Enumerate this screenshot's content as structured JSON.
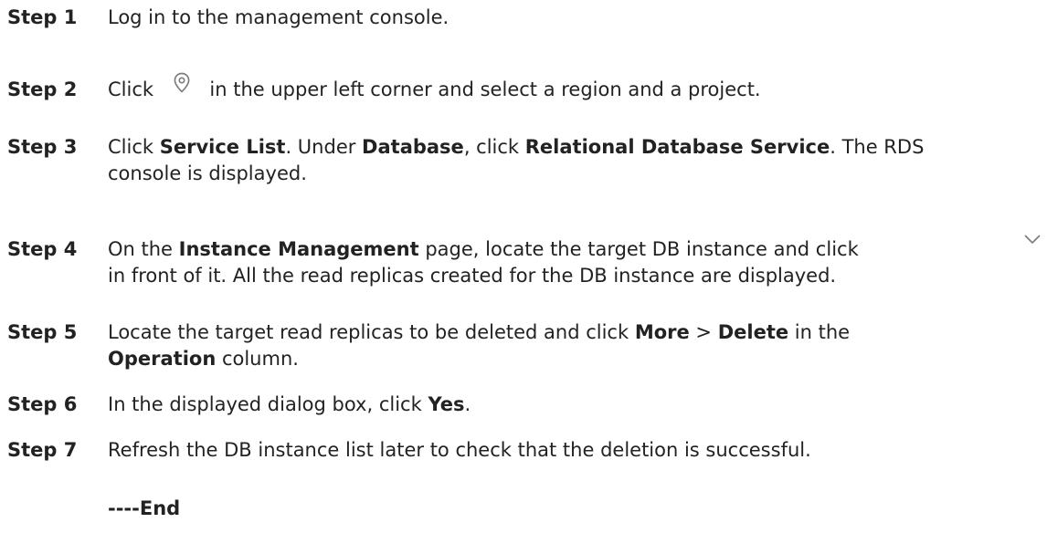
{
  "steps": [
    {
      "label": "Step 1",
      "lines": [
        [
          "Log in to the management console."
        ]
      ]
    },
    {
      "label": "Step 2",
      "before_icon": "Click ",
      "icon": "location-pin-icon",
      "after_icon": " in the upper left corner and select a region and a project."
    },
    {
      "label": "Step 3",
      "parts": [
        "Click ",
        "Service List",
        ". Under ",
        "Database",
        ", click ",
        "Relational Database Service",
        ". The RDS",
        "console is displayed."
      ]
    },
    {
      "label": "Step 4",
      "parts": [
        "On the ",
        "Instance Management",
        " page, locate the target DB instance and click",
        "in front of it. All the read replicas created for the DB instance are displayed."
      ],
      "icon": "chevron-down-icon"
    },
    {
      "label": "Step 5",
      "parts": [
        "Locate the target read replicas to be deleted and click ",
        "More",
        " > ",
        "Delete",
        " in the",
        "Operation",
        " column."
      ]
    },
    {
      "label": "Step 6",
      "parts": [
        "In the displayed dialog box, click ",
        "Yes",
        "."
      ]
    },
    {
      "label": "Step 7",
      "parts": [
        "Refresh the DB instance list later to check that the deletion is successful."
      ]
    }
  ],
  "end_marker": "----End",
  "colors": {
    "text": "#222222",
    "icon_stroke": "#7d7d7d",
    "background": "#ffffff"
  }
}
